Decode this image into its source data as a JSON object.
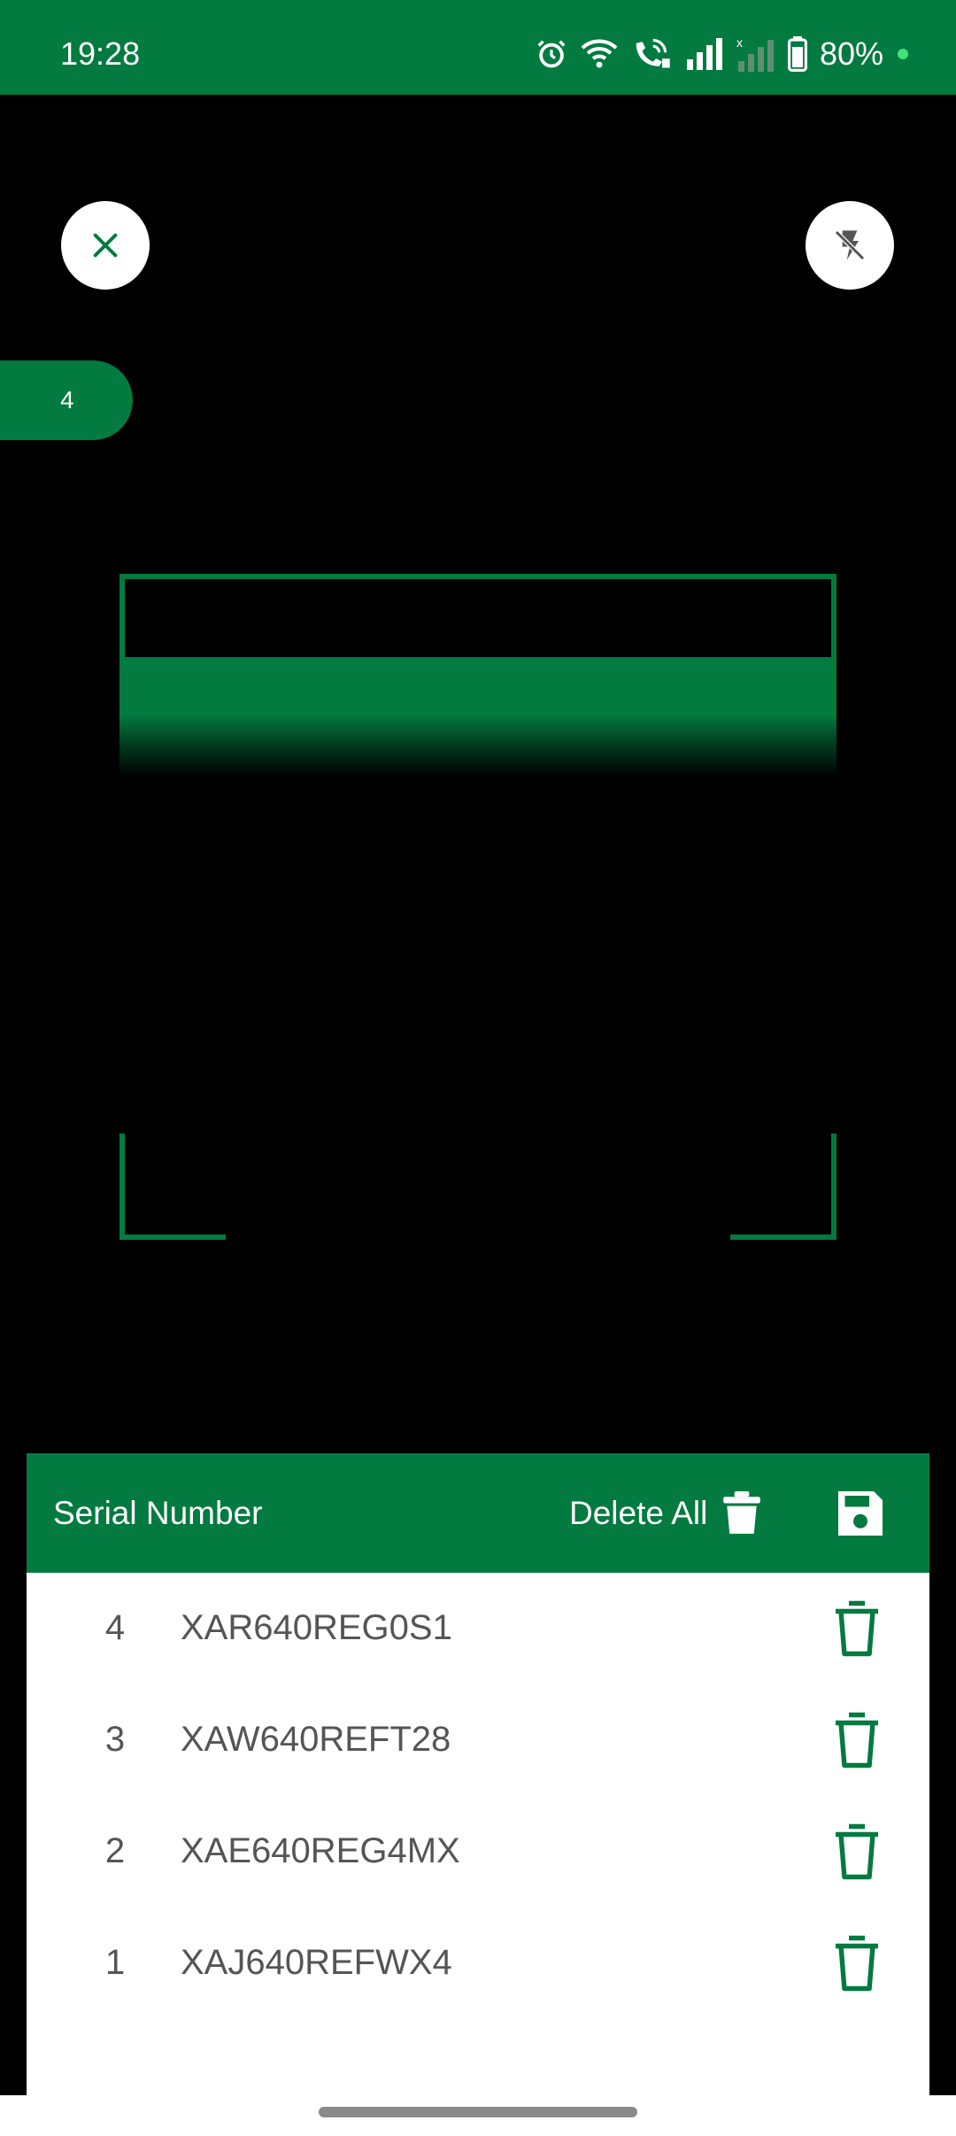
{
  "status_bar": {
    "time": "19:28",
    "battery_percent": "80%",
    "icons": [
      "alarm-icon",
      "wifi-icon",
      "wifi-calling-icon",
      "signal-icon",
      "signal-no-sim-icon",
      "battery-icon"
    ]
  },
  "scanner": {
    "scan_count": "4",
    "close_icon": "close-icon",
    "flash_icon": "flash-off-icon",
    "accent_color": "#037a3f"
  },
  "panel": {
    "title": "Serial Number",
    "delete_all_label": "Delete All",
    "items": [
      {
        "index": "4",
        "serial": "XAR640REG0S1"
      },
      {
        "index": "3",
        "serial": "XAW640REFT28"
      },
      {
        "index": "2",
        "serial": "XAE640REG4MX"
      },
      {
        "index": "1",
        "serial": "XAJ640REFWX4"
      }
    ]
  }
}
